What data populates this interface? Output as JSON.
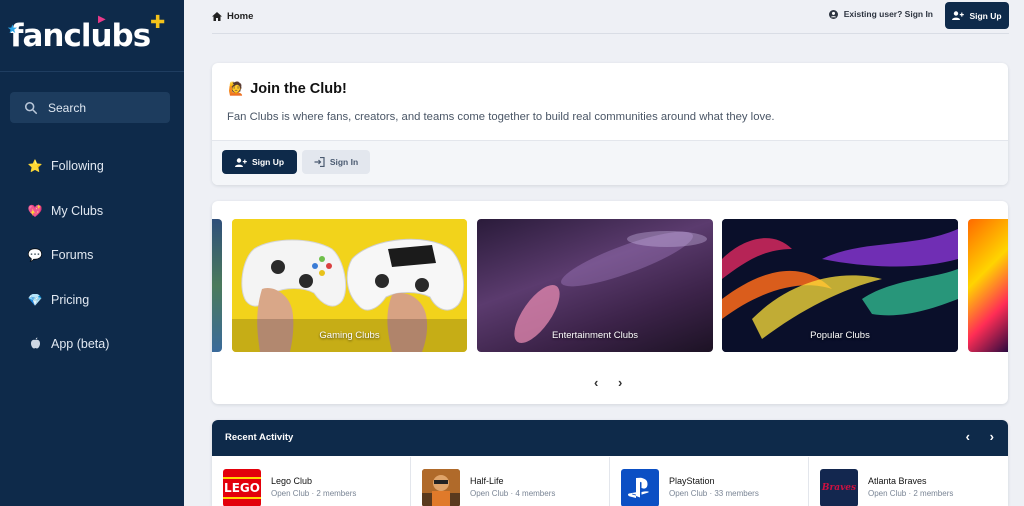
{
  "logo": {
    "text": "fanclubs"
  },
  "sidebar": {
    "search_label": "Search",
    "items": [
      {
        "label": "Following",
        "icon": "star-icon",
        "glyph": "⭐"
      },
      {
        "label": "My Clubs",
        "icon": "heart-icon",
        "glyph": "💖"
      },
      {
        "label": "Forums",
        "icon": "speech-bubble-icon",
        "glyph": "💬"
      },
      {
        "label": "Pricing",
        "icon": "diamond-icon",
        "glyph": "💎"
      },
      {
        "label": "App (beta)",
        "icon": "apple-icon",
        "glyph": ""
      }
    ]
  },
  "topbar": {
    "home_label": "Home",
    "existing_label": "Existing user? Sign In",
    "signup_label": "Sign Up"
  },
  "join": {
    "emoji": "🙋",
    "title": "Join the Club!",
    "description": "Fan Clubs is where fans, creators, and teams come together to build real communities around what they love.",
    "signup_label": "Sign Up",
    "signin_label": "Sign In"
  },
  "carousel": {
    "slides": [
      {
        "label": "Gaming Clubs"
      },
      {
        "label": "Entertainment Clubs"
      },
      {
        "label": "Popular Clubs"
      }
    ],
    "prev": "‹",
    "next": "›"
  },
  "activity": {
    "title": "Recent Activity",
    "prev": "‹",
    "next": "›",
    "clubs": [
      {
        "name": "Lego Club",
        "meta": "Open Club · 2 members",
        "logo_text": "LEGO"
      },
      {
        "name": "Half-Life",
        "meta": "Open Club · 4 members",
        "logo_text": ""
      },
      {
        "name": "PlayStation",
        "meta": "Open Club · 33 members",
        "logo_text": ""
      },
      {
        "name": "Atlanta Braves",
        "meta": "Open Club · 2 members",
        "logo_text": "Braves"
      }
    ]
  },
  "colors": {
    "sidebar_bg": "#0e2a4a",
    "primary_button": "#0e2a4a",
    "page_bg": "#eef0f5",
    "gaming_slide": "#f2d31b"
  }
}
